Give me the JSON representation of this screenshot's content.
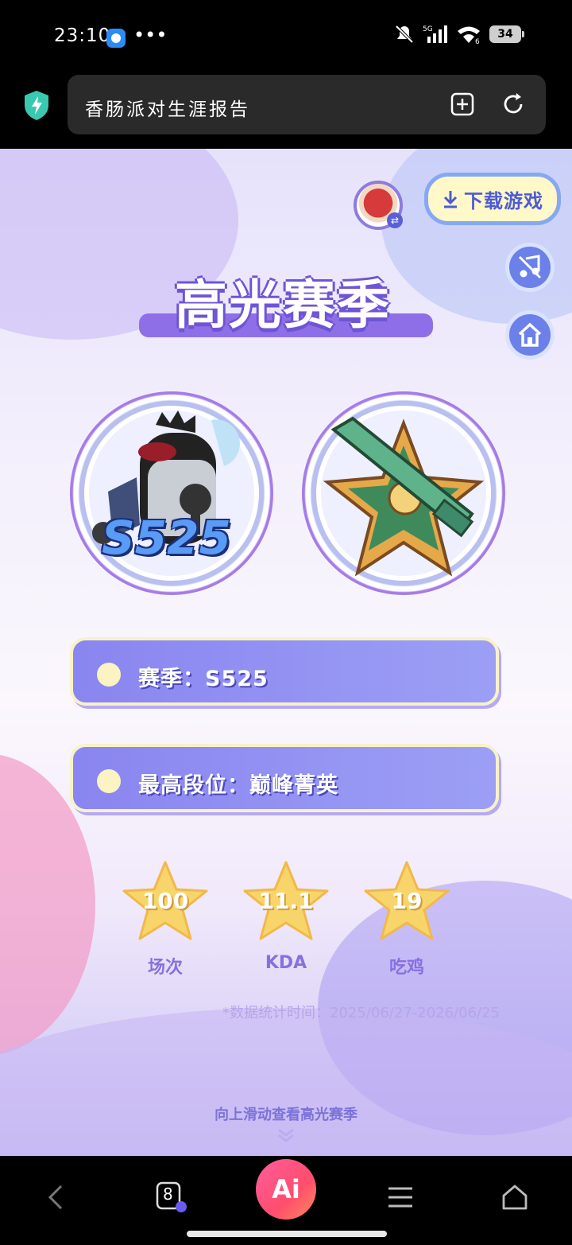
{
  "status_bar": {
    "time": "23:10",
    "more": "•••",
    "battery": "34",
    "icons": [
      "mute-icon",
      "5g-signal-icon",
      "wifi-icon",
      "battery-icon"
    ]
  },
  "browser": {
    "title": "香肠派对生涯报告",
    "icons": [
      "shield-icon",
      "add-tab-icon",
      "refresh-icon"
    ]
  },
  "page": {
    "download_button": "下载游戏",
    "title": "高光赛季",
    "season_medal_label": "S525",
    "info_rows": [
      {
        "text": "赛季：S525"
      },
      {
        "text": "最高段位：巅峰菁英"
      }
    ],
    "stats": [
      {
        "value": "100",
        "label": "场次"
      },
      {
        "value": "11.1",
        "label": "KDA"
      },
      {
        "value": "19",
        "label": "吃鸡"
      }
    ],
    "data_note": "*数据统计时间：2025/06/27-2026/06/25",
    "scroll_hint": "向上滑动查看高光赛季"
  },
  "bottom_nav": {
    "tab_count": "8",
    "ai_label": "Ai",
    "icons": [
      "back-icon",
      "tabs-icon",
      "ai-icon",
      "menu-icon",
      "home-icon"
    ]
  },
  "colors": {
    "accent_purple": "#8f6fe8",
    "info_bar": "#8a85f0",
    "ai_pink": "#ff4d6d",
    "star_gold": "#f7d56a"
  }
}
